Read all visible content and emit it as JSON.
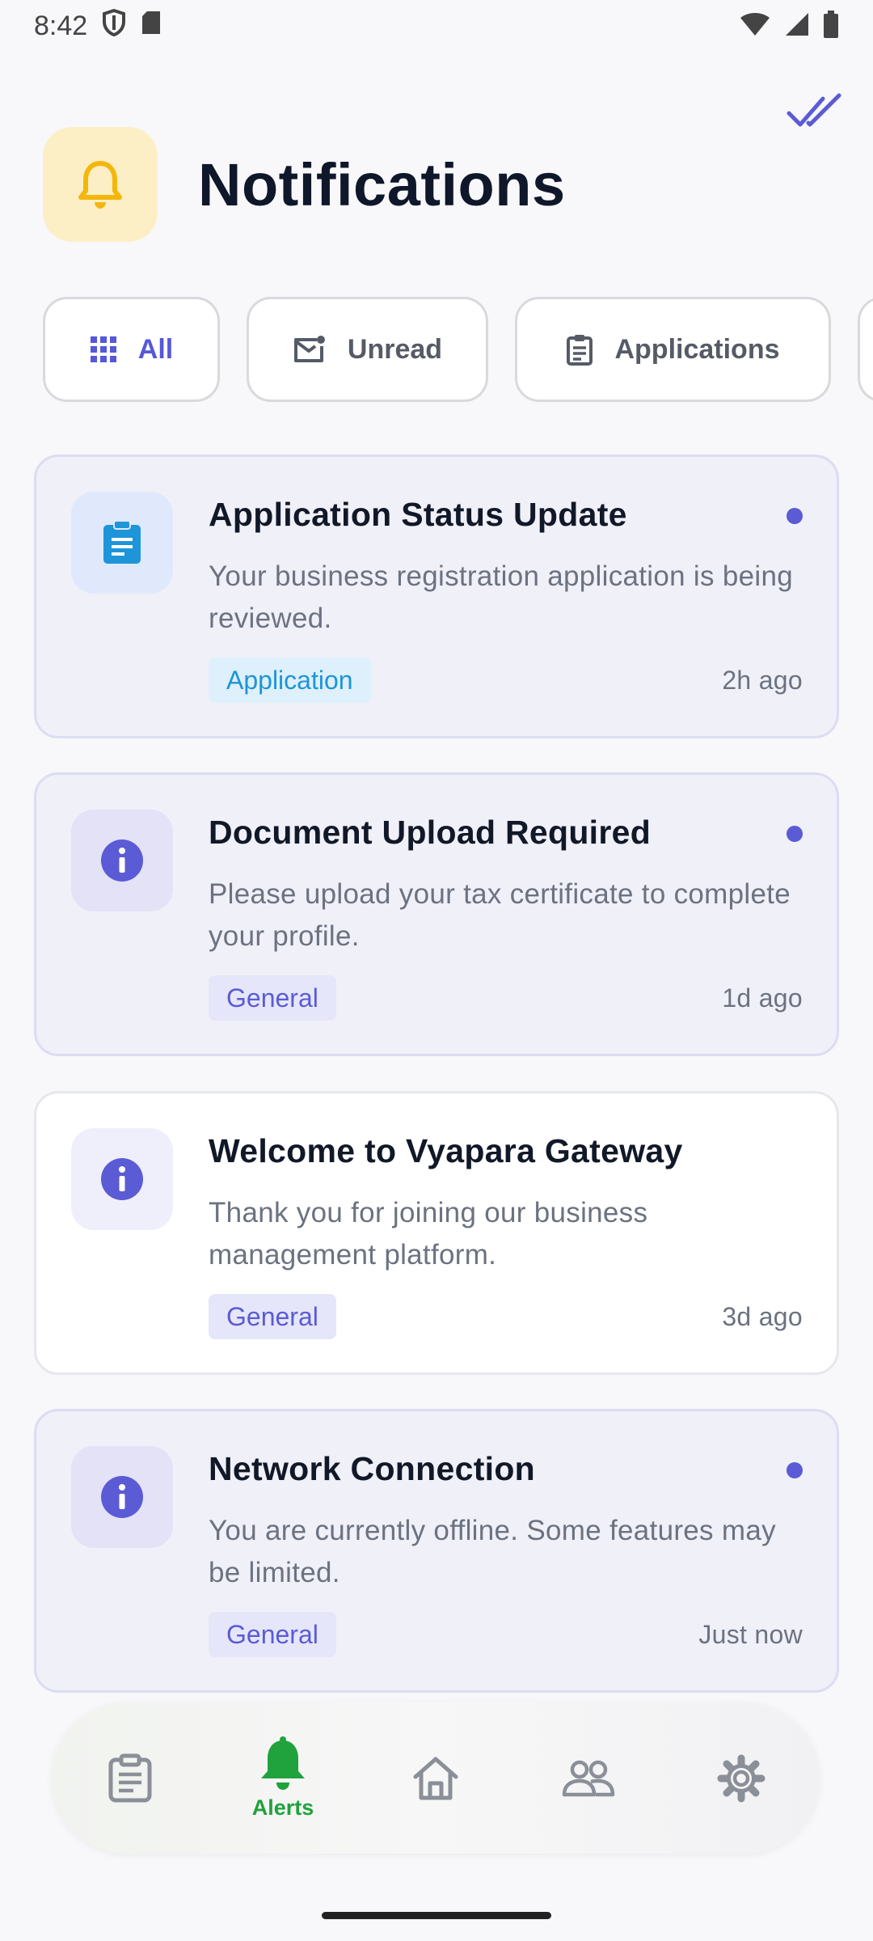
{
  "status_bar": {
    "time": "8:42"
  },
  "header": {
    "title": "Notifications"
  },
  "filters": [
    {
      "label": "All",
      "icon": "grid-icon",
      "active": true
    },
    {
      "label": "Unread",
      "icon": "mail-unread-icon",
      "active": false
    },
    {
      "label": "Applications",
      "icon": "clipboard-icon",
      "active": false
    }
  ],
  "notifications": [
    {
      "title": "Application Status Update",
      "body": "Your business registration application is being reviewed.",
      "tag": "Application",
      "time": "2h ago",
      "unread": true,
      "icon": "clipboard-icon"
    },
    {
      "title": "Document Upload Required",
      "body": "Please upload your tax certificate to complete your profile.",
      "tag": "General",
      "time": "1d ago",
      "unread": true,
      "icon": "info-icon"
    },
    {
      "title": "Welcome to Vyapara Gateway",
      "body": "Thank you for joining our business management platform.",
      "tag": "General",
      "time": "3d ago",
      "unread": false,
      "icon": "info-icon"
    },
    {
      "title": "Network Connection",
      "body": "You are currently offline. Some features may be limited.",
      "tag": "General",
      "time": "Just now",
      "unread": true,
      "icon": "info-icon"
    }
  ],
  "bottom_nav": {
    "items": [
      {
        "name": "applications",
        "icon": "clipboard-icon",
        "label": ""
      },
      {
        "name": "alerts",
        "icon": "bell-icon",
        "label": "Alerts",
        "active": true
      },
      {
        "name": "home",
        "icon": "home-icon",
        "label": ""
      },
      {
        "name": "people",
        "icon": "people-icon",
        "label": ""
      },
      {
        "name": "settings",
        "icon": "gear-icon",
        "label": ""
      }
    ]
  },
  "colors": {
    "accent": "#5b5bd6",
    "active_nav": "#20a23d",
    "bell": "#f3b70b",
    "application_tag": "#1e95d8",
    "unread_card_bg": "#f0f0f8"
  }
}
